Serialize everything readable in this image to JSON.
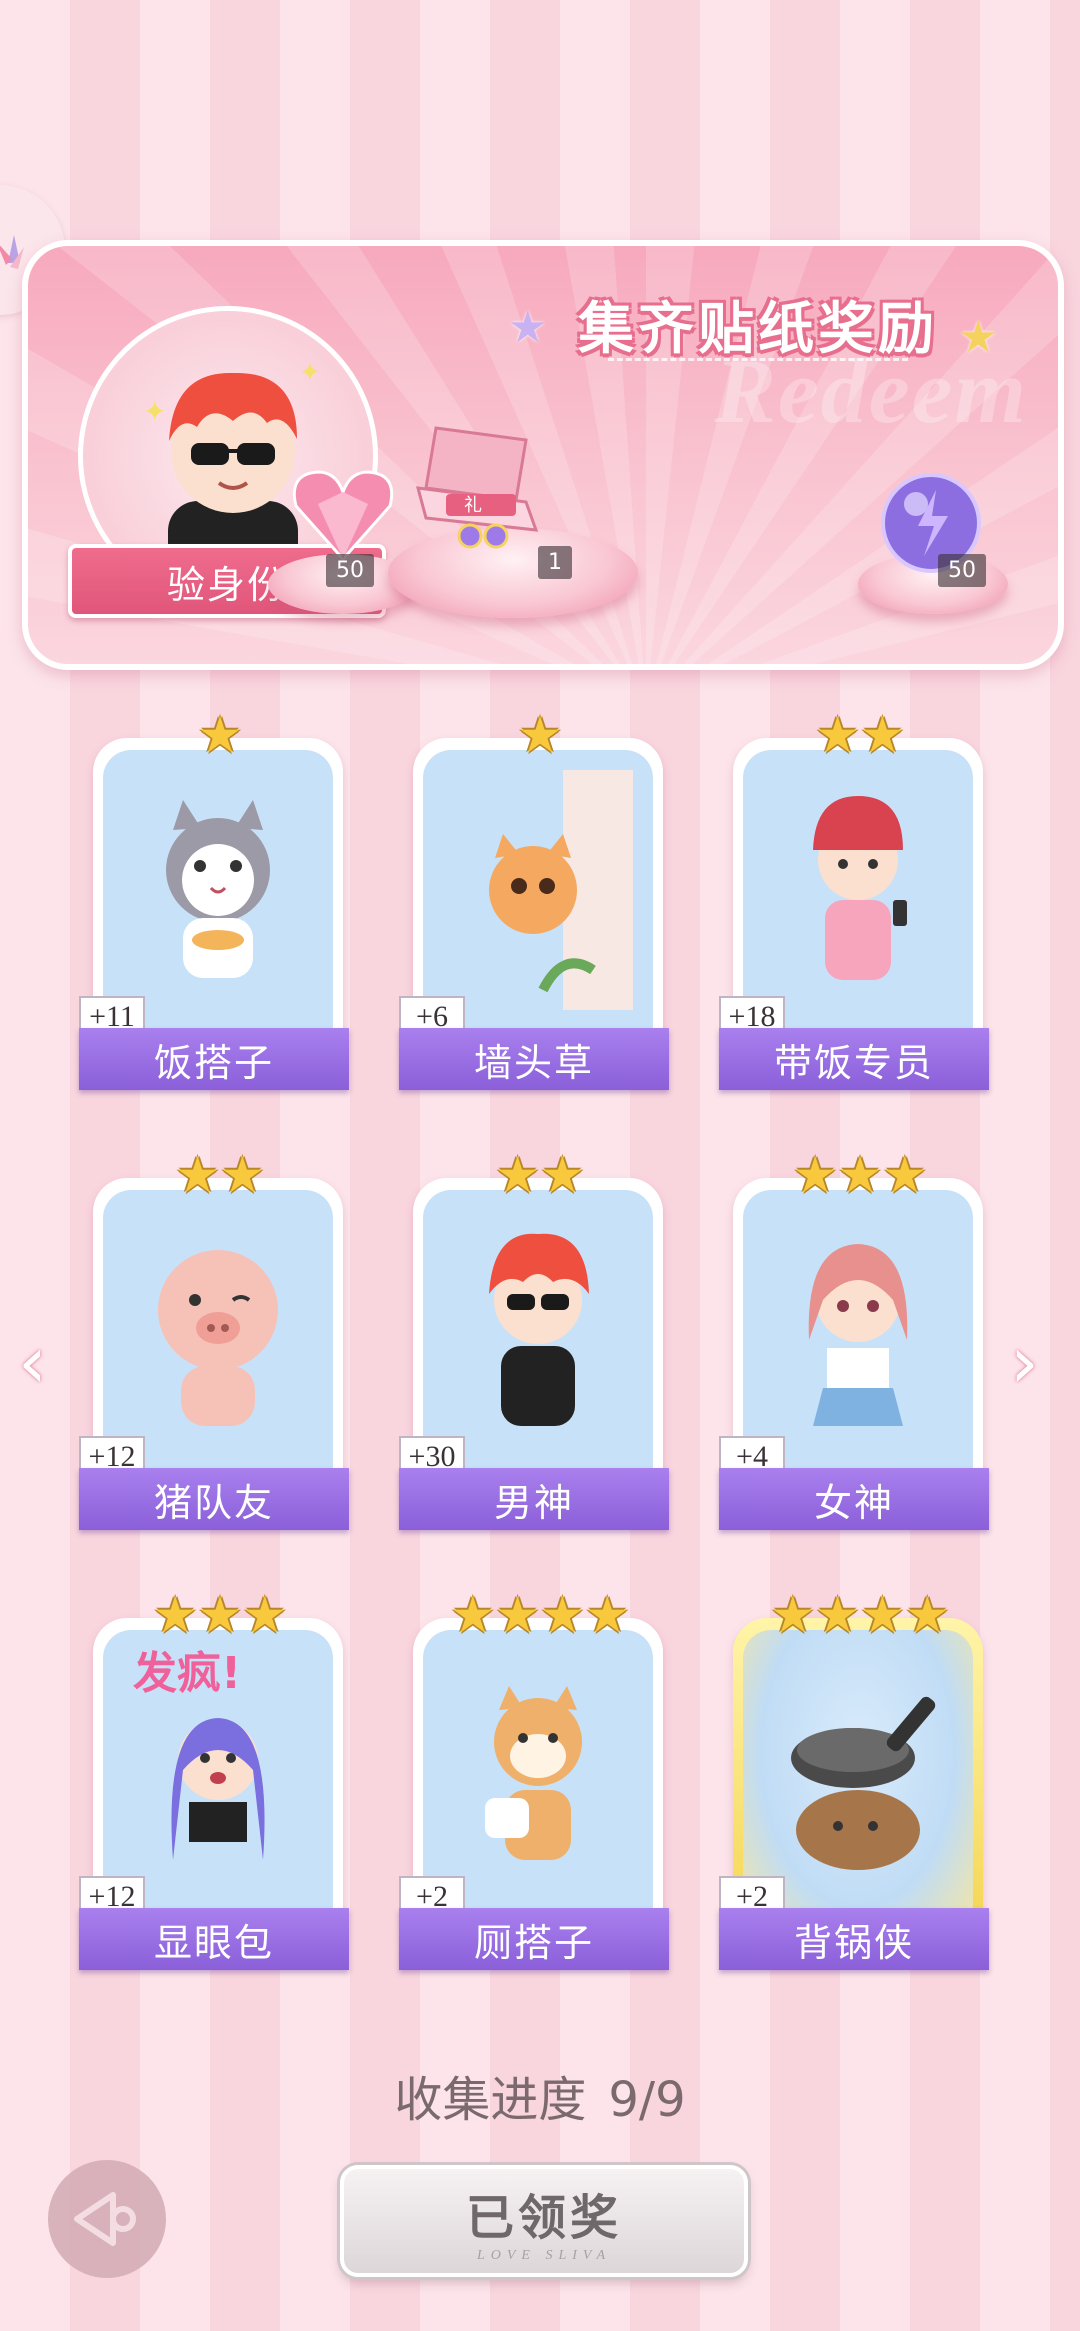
{
  "reward_panel": {
    "title": "集齐贴纸奖励",
    "watermark": "Redeem",
    "verify_label": "验身份",
    "rewards": [
      {
        "icon": "pink-heart-gem-icon",
        "count": "50"
      },
      {
        "icon": "gift-box-icon",
        "count": "1"
      },
      {
        "icon": "purple-energy-orb-icon",
        "count": "50"
      }
    ]
  },
  "cards": [
    {
      "label": "饭搭子",
      "bonus": "+11",
      "stars": 1,
      "icon": "cat-with-cake-sticker"
    },
    {
      "label": "墙头草",
      "bonus": "+6",
      "stars": 1,
      "icon": "cat-peeking-wall-sticker"
    },
    {
      "label": "带饭专员",
      "bonus": "+18",
      "stars": 2,
      "icon": "girl-with-phone-sticker"
    },
    {
      "label": "猪队友",
      "bonus": "+12",
      "stars": 2,
      "icon": "pig-wink-sticker"
    },
    {
      "label": "男神",
      "bonus": "+30",
      "stars": 2,
      "icon": "boy-sunglasses-sticker"
    },
    {
      "label": "女神",
      "bonus": "+4",
      "stars": 3,
      "icon": "girl-sailor-sticker"
    },
    {
      "label": "显眼包",
      "bonus": "+12",
      "stars": 3,
      "icon": "crazy-girl-sticker",
      "caption": "发疯!"
    },
    {
      "label": "厕搭子",
      "bonus": "+2",
      "stars": 4,
      "icon": "shiba-toilet-paper-sticker"
    },
    {
      "label": "背锅侠",
      "bonus": "+2",
      "stars": 4,
      "icon": "capybara-pan-sticker",
      "gold": true
    }
  ],
  "progress": {
    "label": "收集进度",
    "value": "9/9"
  },
  "claim_button": {
    "label": "已领奖",
    "sub": "LOVE SLIVA"
  },
  "colors": {
    "accent_pink": "#e76e8c",
    "label_purple": "#8a5fd9",
    "star_gold": "#f8c93c"
  }
}
